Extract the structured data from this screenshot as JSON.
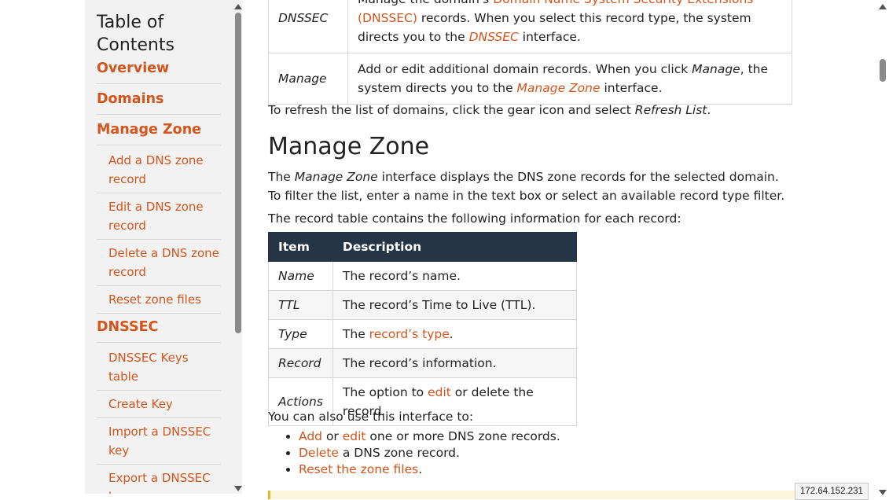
{
  "toc": {
    "title": "Table of Contents",
    "items": [
      {
        "label": "Overview",
        "level": 1
      },
      {
        "label": "Domains",
        "level": 1
      },
      {
        "label": "Manage Zone",
        "level": 1
      },
      {
        "label": "Add a DNS zone record",
        "level": 2
      },
      {
        "label": "Edit a DNS zone record",
        "level": 2
      },
      {
        "label": "Delete a DNS zone record",
        "level": 2
      },
      {
        "label": "Reset zone files",
        "level": 2
      },
      {
        "label": "DNSSEC",
        "level": 1
      },
      {
        "label": "DNSSEC Keys table",
        "level": 2
      },
      {
        "label": "Create Key",
        "level": 2
      },
      {
        "label": "Import a DNSSEC key",
        "level": 2
      },
      {
        "label": "Export a DNSSEC key",
        "level": 2
      }
    ]
  },
  "top_table": {
    "rows": [
      {
        "item": "DNSSEC",
        "desc_part1": "Manage the domain's ",
        "desc_link1": "Domain Name System Security Extensions (DNSSEC)",
        "desc_part2": " records. When you select this record type, the system directs you to the ",
        "desc_link2": "DNSSEC",
        "desc_part3": " interface."
      },
      {
        "item": "Manage",
        "desc_part1": "Add or edit additional domain records. When you click ",
        "desc_em": "Manage",
        "desc_part2": ", the system directs you to the ",
        "desc_link": "Manage Zone",
        "desc_part3": " interface."
      }
    ]
  },
  "refresh": {
    "text": "To refresh the list of domains, click the gear icon and select ",
    "em": "Refresh List",
    "end": "."
  },
  "manage_zone": {
    "heading": "Manage Zone",
    "intro_pre": "The ",
    "intro_em": "Manage Zone",
    "intro_post": " interface displays the DNS zone records for the selected domain. To filter the list, enter a name in the text box or select an available record type filter.",
    "contains": "The record table contains the following information for each record:",
    "table": {
      "headers": [
        "Item",
        "Description"
      ],
      "rows": [
        {
          "item": "Name",
          "pre": "The record’s name.",
          "link": "",
          "post": ""
        },
        {
          "item": "TTL",
          "pre": "The record’s Time to Live (TTL).",
          "link": "",
          "post": ""
        },
        {
          "item": "Type",
          "pre": "The ",
          "link": "record’s type",
          "post": "."
        },
        {
          "item": "Record",
          "pre": "The record’s information.",
          "link": "",
          "post": ""
        },
        {
          "item": "Actions",
          "pre": "The option to ",
          "link": "edit",
          "post": " or delete the record."
        }
      ]
    },
    "also": "You can also use this interface to:",
    "uses": [
      {
        "link": "Add",
        "mid": " or ",
        "link2": "edit",
        "post": " one or more DNS zone records."
      },
      {
        "link": "Delete",
        "mid": "",
        "link2": "",
        "post": " a DNS zone record."
      },
      {
        "link": "Reset the zone files",
        "mid": "",
        "link2": "",
        "post": "."
      }
    ]
  },
  "status": {
    "ip": "172.64.152.231"
  },
  "colors": {
    "accent": "#d4541b",
    "table_header": "#263545",
    "sidebar_bg": "#f2f2f2"
  }
}
